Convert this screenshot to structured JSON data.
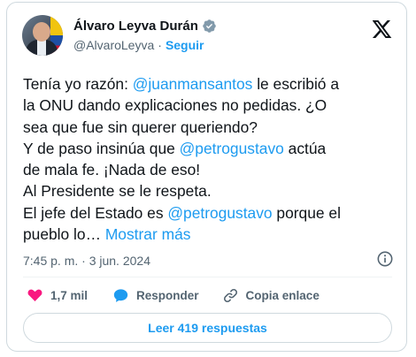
{
  "author": {
    "name": "Álvaro Leyva Durán",
    "handle": "@AlvaroLeyva",
    "separator": "·",
    "follow_label": "Seguir"
  },
  "tweet": {
    "lines": [
      [
        {
          "t": "Tenía yo razón: "
        },
        {
          "t": "@juanmansantos",
          "m": true
        },
        {
          "t": " le escribió a"
        }
      ],
      [
        {
          "t": "la ONU dando explicaciones no pedidas. ¿O"
        }
      ],
      [
        {
          "t": "sea que fue sin querer queriendo?"
        }
      ],
      [
        {
          "t": "Y de paso insinúa que "
        },
        {
          "t": "@petrogustavo",
          "m": true
        },
        {
          "t": " actúa"
        }
      ],
      [
        {
          "t": "de mala fe. ¡Nada de eso!"
        }
      ],
      [
        {
          "t": "Al Presidente se le respeta."
        }
      ],
      [
        {
          "t": "El jefe del Estado es "
        },
        {
          "t": "@petrogustavo",
          "m": true
        },
        {
          "t": " porque el"
        }
      ],
      [
        {
          "t": "pueblo lo… "
        },
        {
          "t": "Mostrar más",
          "m": true
        }
      ]
    ],
    "timestamp": "7:45 p. m. · 3 jun. 2024"
  },
  "actions": {
    "likes": "1,7 mil",
    "reply_label": "Responder",
    "copy_link_label": "Copia enlace"
  },
  "read_replies_label": "Leer 419 respuestas",
  "colors": {
    "accent": "#1d9bf0",
    "like": "#f91880",
    "text": "#0f1419",
    "muted": "#536471",
    "border": "#cfd9de"
  },
  "icons": {
    "verified": "verified-badge-icon",
    "logo": "x-logo-icon",
    "info": "info-icon",
    "like": "heart-icon",
    "reply": "speech-bubble-icon",
    "copy": "link-icon"
  }
}
